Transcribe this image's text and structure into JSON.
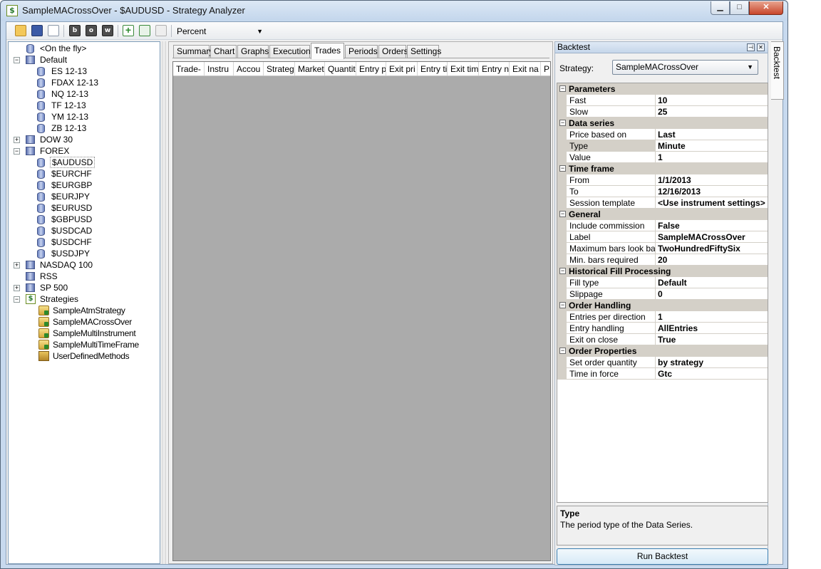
{
  "window": {
    "title": "SampleMACrossOver - $AUDUSD - Strategy Analyzer",
    "app_icon_glyph": "$",
    "minimize": "▁",
    "maximize": "□",
    "close": "✕"
  },
  "toolbar": {
    "b_label": "b",
    "o_label": "o",
    "w_label": "w",
    "add_label": "+",
    "display_value": "Percent",
    "dropdown_arrow": "▼"
  },
  "tree": {
    "on_the_fly": "<On the fly>",
    "default": "Default",
    "default_items": [
      "ES 12-13",
      "FDAX 12-13",
      "NQ 12-13",
      "TF 12-13",
      "YM 12-13",
      "ZB 12-13"
    ],
    "dow30": "DOW 30",
    "forex": "FOREX",
    "forex_items": [
      "$AUDUSD",
      "$EURCHF",
      "$EURGBP",
      "$EURJPY",
      "$EURUSD",
      "$GBPUSD",
      "$USDCAD",
      "$USDCHF",
      "$USDJPY"
    ],
    "nasdaq": "NASDAQ 100",
    "rss": "RSS",
    "sp500": "SP 500",
    "strategies": "Strategies",
    "strategy_items": [
      "SampleAtmStrategy",
      "SampleMACrossOver",
      "SampleMultiInstrument",
      "SampleMultiTimeFrame",
      "UserDefinedMethods"
    ],
    "collapse_glyph": "−",
    "expand_glyph": "+",
    "strategy_icon_glyph": "$"
  },
  "tabs": [
    "Summary",
    "Chart",
    "Graphs",
    "Executions",
    "Trades",
    "Periods",
    "Orders",
    "Settings"
  ],
  "active_tab": "Trades",
  "grid": {
    "columns": [
      "Trade-",
      "Instru",
      "Accou",
      "Strateg",
      "Market",
      "Quantit",
      "Entry p",
      "Exit pri",
      "Entry ti",
      "Exit tim",
      "Entry n",
      "Exit na",
      "P"
    ]
  },
  "backtest": {
    "header": "Backtest",
    "pin": "⊣",
    "close": "✕",
    "strategy_label": "Strategy:",
    "strategy_value": "SampleMACrossOver",
    "categories": [
      {
        "name": "Parameters",
        "rows": [
          [
            "Fast",
            "10"
          ],
          [
            "Slow",
            "25"
          ]
        ]
      },
      {
        "name": "Data series",
        "rows": [
          [
            "Price based on",
            "Last"
          ],
          [
            "Type",
            "Minute"
          ],
          [
            "Value",
            "1"
          ]
        ]
      },
      {
        "name": "Time frame",
        "rows": [
          [
            "From",
            "1/1/2013"
          ],
          [
            "To",
            "12/16/2013"
          ],
          [
            "Session template",
            "<Use instrument settings>"
          ]
        ]
      },
      {
        "name": "General",
        "rows": [
          [
            "Include commission",
            "False"
          ],
          [
            "Label",
            "SampleMACrossOver"
          ],
          [
            "Maximum bars look back",
            "TwoHundredFiftySix"
          ],
          [
            "Min. bars required",
            "20"
          ]
        ]
      },
      {
        "name": "Historical Fill Processing",
        "rows": [
          [
            "Fill type",
            "Default"
          ],
          [
            "Slippage",
            "0"
          ]
        ]
      },
      {
        "name": "Order Handling",
        "rows": [
          [
            "Entries per direction",
            "1"
          ],
          [
            "Entry handling",
            "AllEntries"
          ],
          [
            "Exit on close",
            "True"
          ]
        ]
      },
      {
        "name": "Order Properties",
        "rows": [
          [
            "Set order quantity",
            "by strategy"
          ],
          [
            "Time in force",
            "Gtc"
          ]
        ]
      }
    ],
    "highlighted_row": "Type",
    "help_title": "Type",
    "help_text": "The period type of the Data Series.",
    "run_button": "Run Backtest",
    "side_tab": "Backtest"
  }
}
